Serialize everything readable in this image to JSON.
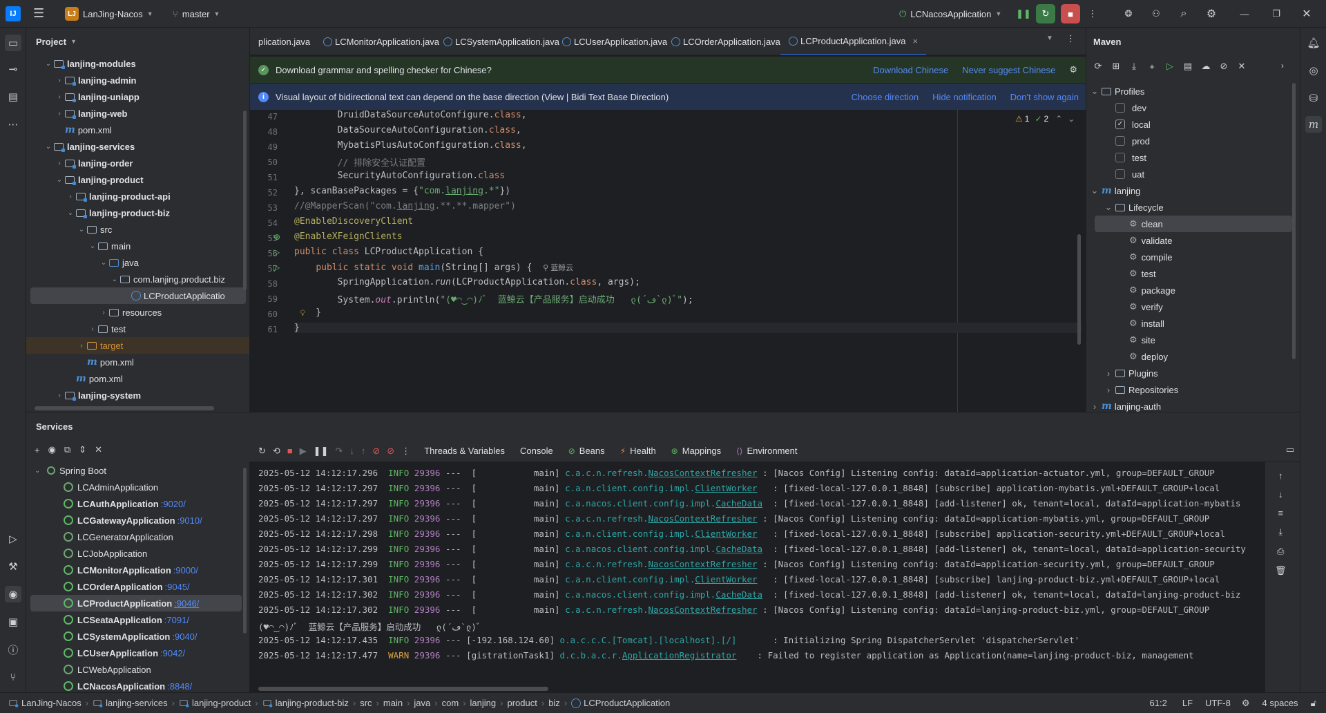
{
  "titlebar": {
    "project_badge": "LJ",
    "project_name": "LanJing-Nacos",
    "branch": "master",
    "run_config": "LCNacosApplication"
  },
  "project_panel": {
    "title": "Project",
    "tree": [
      {
        "label": "lanjing-modules",
        "depth": 1,
        "kind": "module",
        "expanded": true,
        "bold": true
      },
      {
        "label": "lanjing-admin",
        "depth": 2,
        "kind": "module",
        "expanded": false,
        "bold": true
      },
      {
        "label": "lanjing-uniapp",
        "depth": 2,
        "kind": "module",
        "expanded": false,
        "bold": true
      },
      {
        "label": "lanjing-web",
        "depth": 2,
        "kind": "module",
        "expanded": false,
        "bold": true
      },
      {
        "label": "pom.xml",
        "depth": 2,
        "kind": "pom"
      },
      {
        "label": "lanjing-services",
        "depth": 1,
        "kind": "module",
        "expanded": true,
        "bold": true
      },
      {
        "label": "lanjing-order",
        "depth": 2,
        "kind": "module",
        "expanded": false,
        "bold": true
      },
      {
        "label": "lanjing-product",
        "depth": 2,
        "kind": "module",
        "expanded": true,
        "bold": true
      },
      {
        "label": "lanjing-product-api",
        "depth": 3,
        "kind": "module",
        "expanded": false,
        "bold": true
      },
      {
        "label": "lanjing-product-biz",
        "depth": 3,
        "kind": "module",
        "expanded": true,
        "bold": true
      },
      {
        "label": "src",
        "depth": 4,
        "kind": "folder",
        "expanded": true
      },
      {
        "label": "main",
        "depth": 5,
        "kind": "folder",
        "expanded": true
      },
      {
        "label": "java",
        "depth": 6,
        "kind": "src",
        "expanded": true
      },
      {
        "label": "com.lanjing.product.biz",
        "depth": 7,
        "kind": "package",
        "expanded": true
      },
      {
        "label": "LCProductApplicatio",
        "depth": 8,
        "kind": "class",
        "selected": true
      },
      {
        "label": "resources",
        "depth": 6,
        "kind": "folder",
        "expanded": false
      },
      {
        "label": "test",
        "depth": 5,
        "kind": "folder",
        "expanded": false
      },
      {
        "label": "target",
        "depth": 4,
        "kind": "target",
        "expanded": false
      },
      {
        "label": "pom.xml",
        "depth": 4,
        "kind": "pom"
      },
      {
        "label": "pom.xml",
        "depth": 3,
        "kind": "pom"
      },
      {
        "label": "lanjing-system",
        "depth": 2,
        "kind": "module",
        "expanded": false,
        "bold": true
      }
    ]
  },
  "tabs": [
    {
      "label": "plication.java",
      "icon": false
    },
    {
      "label": "LCMonitorApplication.java",
      "icon": true
    },
    {
      "label": "LCSystemApplication.java",
      "icon": true
    },
    {
      "label": "LCUserApplication.java",
      "icon": true
    },
    {
      "label": "LCOrderApplication.java",
      "icon": true
    },
    {
      "label": "LCProductApplication.java",
      "icon": true,
      "active": true
    }
  ],
  "notifications": {
    "grammar": {
      "text": "Download grammar and spelling checker for Chinese?",
      "action1": "Download Chinese",
      "action2": "Never suggest Chinese"
    },
    "bidi": {
      "text": "Visual layout of bidirectional text can depend on the base direction (View | Bidi Text Base Direction)",
      "action1": "Choose direction",
      "action2": "Hide notification",
      "action3": "Don't show again"
    }
  },
  "editor": {
    "inspections": {
      "warnings": "1",
      "ok": "2"
    },
    "author_hint": "蓝鲸云",
    "line_numbers": [
      "47",
      "48",
      "49",
      "50",
      "51",
      "52",
      "53",
      "54",
      "55",
      "56",
      "57",
      "58",
      "59",
      "60",
      "61"
    ]
  },
  "maven": {
    "title": "Maven",
    "tree": [
      {
        "label": "Profiles",
        "depth": 1,
        "kind": "folder",
        "expanded": true
      },
      {
        "label": "dev",
        "depth": 2,
        "kind": "check",
        "checked": false
      },
      {
        "label": "local",
        "depth": 2,
        "kind": "check",
        "checked": true
      },
      {
        "label": "prod",
        "depth": 2,
        "kind": "check",
        "checked": false
      },
      {
        "label": "test",
        "depth": 2,
        "kind": "check",
        "checked": false
      },
      {
        "label": "uat",
        "depth": 2,
        "kind": "check",
        "checked": false
      },
      {
        "label": "lanjing",
        "depth": 1,
        "kind": "mvn",
        "expanded": true
      },
      {
        "label": "Lifecycle",
        "depth": 2,
        "kind": "folder",
        "expanded": true
      },
      {
        "label": "clean",
        "depth": 3,
        "kind": "goal",
        "selected": true
      },
      {
        "label": "validate",
        "depth": 3,
        "kind": "goal"
      },
      {
        "label": "compile",
        "depth": 3,
        "kind": "goal"
      },
      {
        "label": "test",
        "depth": 3,
        "kind": "goal"
      },
      {
        "label": "package",
        "depth": 3,
        "kind": "goal"
      },
      {
        "label": "verify",
        "depth": 3,
        "kind": "goal"
      },
      {
        "label": "install",
        "depth": 3,
        "kind": "goal"
      },
      {
        "label": "site",
        "depth": 3,
        "kind": "goal"
      },
      {
        "label": "deploy",
        "depth": 3,
        "kind": "goal"
      },
      {
        "label": "Plugins",
        "depth": 2,
        "kind": "folder",
        "expanded": false
      },
      {
        "label": "Repositories",
        "depth": 2,
        "kind": "folder",
        "expanded": false
      },
      {
        "label": "lanjing-auth",
        "depth": 1,
        "kind": "mvn",
        "expanded": false
      }
    ]
  },
  "services": {
    "title": "Services",
    "group": "Spring Boot",
    "apps": [
      {
        "name": "LCAdminApplication",
        "port": "",
        "running": false
      },
      {
        "name": "LCAuthApplication",
        "port": ":9020/",
        "running": true
      },
      {
        "name": "LCGatewayApplication",
        "port": ":9010/",
        "running": true
      },
      {
        "name": "LCGeneratorApplication",
        "port": "",
        "running": false
      },
      {
        "name": "LCJobApplication",
        "port": "",
        "running": false
      },
      {
        "name": "LCMonitorApplication",
        "port": ":9000/",
        "running": true
      },
      {
        "name": "LCOrderApplication",
        "port": ":9045/",
        "running": true
      },
      {
        "name": "LCProductApplication",
        "port": ":9046/",
        "running": true,
        "selected": true
      },
      {
        "name": "LCSeataApplication",
        "port": ":7091/",
        "running": true
      },
      {
        "name": "LCSystemApplication",
        "port": ":9040/",
        "running": true
      },
      {
        "name": "LCUserApplication",
        "port": ":9042/",
        "running": true
      },
      {
        "name": "LCWebApplication",
        "port": "",
        "running": false
      },
      {
        "name": "LCNacosApplication",
        "port": ":8848/",
        "running": true
      }
    ],
    "console_tabs": [
      "Threads & Variables",
      "Console",
      "Beans",
      "Health",
      "Mappings",
      "Environment"
    ]
  },
  "console_log": [
    {
      "ts": "2025-05-12 14:12:17.296",
      "level": "INFO",
      "pid": "29396",
      "thread": "---  [           main]",
      "logger_pre": "c.a.c.n.refresh.",
      "logger_link": "NacosContextRefresher",
      "msg": " : [Nacos Config] Listening config: dataId=application-actuator.yml, group=DEFAULT_GROUP"
    },
    {
      "ts": "2025-05-12 14:12:17.297",
      "level": "INFO",
      "pid": "29396",
      "thread": "---  [           main]",
      "logger_pre": "c.a.n.client.config.impl.",
      "logger_link": "ClientWorker",
      "msg": "   : [fixed-local-127.0.0.1_8848] [subscribe] application-mybatis.yml+DEFAULT_GROUP+local"
    },
    {
      "ts": "2025-05-12 14:12:17.297",
      "level": "INFO",
      "pid": "29396",
      "thread": "---  [           main]",
      "logger_pre": "c.a.nacos.client.config.impl.",
      "logger_link": "CacheData",
      "msg": "  : [fixed-local-127.0.0.1_8848] [add-listener] ok, tenant=local, dataId=application-mybatis"
    },
    {
      "ts": "2025-05-12 14:12:17.297",
      "level": "INFO",
      "pid": "29396",
      "thread": "---  [           main]",
      "logger_pre": "c.a.c.n.refresh.",
      "logger_link": "NacosContextRefresher",
      "msg": " : [Nacos Config] Listening config: dataId=application-mybatis.yml, group=DEFAULT_GROUP"
    },
    {
      "ts": "2025-05-12 14:12:17.298",
      "level": "INFO",
      "pid": "29396",
      "thread": "---  [           main]",
      "logger_pre": "c.a.n.client.config.impl.",
      "logger_link": "ClientWorker",
      "msg": "   : [fixed-local-127.0.0.1_8848] [subscribe] application-security.yml+DEFAULT_GROUP+local"
    },
    {
      "ts": "2025-05-12 14:12:17.299",
      "level": "INFO",
      "pid": "29396",
      "thread": "---  [           main]",
      "logger_pre": "c.a.nacos.client.config.impl.",
      "logger_link": "CacheData",
      "msg": "  : [fixed-local-127.0.0.1_8848] [add-listener] ok, tenant=local, dataId=application-security"
    },
    {
      "ts": "2025-05-12 14:12:17.299",
      "level": "INFO",
      "pid": "29396",
      "thread": "---  [           main]",
      "logger_pre": "c.a.c.n.refresh.",
      "logger_link": "NacosContextRefresher",
      "msg": " : [Nacos Config] Listening config: dataId=application-security.yml, group=DEFAULT_GROUP"
    },
    {
      "ts": "2025-05-12 14:12:17.301",
      "level": "INFO",
      "pid": "29396",
      "thread": "---  [           main]",
      "logger_pre": "c.a.n.client.config.impl.",
      "logger_link": "ClientWorker",
      "msg": "   : [fixed-local-127.0.0.1_8848] [subscribe] lanjing-product-biz.yml+DEFAULT_GROUP+local"
    },
    {
      "ts": "2025-05-12 14:12:17.302",
      "level": "INFO",
      "pid": "29396",
      "thread": "---  [           main]",
      "logger_pre": "c.a.nacos.client.config.impl.",
      "logger_link": "CacheData",
      "msg": "  : [fixed-local-127.0.0.1_8848] [add-listener] ok, tenant=local, dataId=lanjing-product-biz"
    },
    {
      "ts": "2025-05-12 14:12:17.302",
      "level": "INFO",
      "pid": "29396",
      "thread": "---  [           main]",
      "logger_pre": "c.a.c.n.refresh.",
      "logger_link": "NacosContextRefresher",
      "msg": " : [Nacos Config] Listening config: dataId=lanjing-product-biz.yml, group=DEFAULT_GROUP"
    },
    {
      "plain": "(♥◠‿◠)ﾉﾞ  蓝鲸云【产品服务】启动成功   ლ(´ڡ`ლ)ﾞ"
    },
    {
      "ts": "2025-05-12 14:12:17.435",
      "level": "INFO",
      "pid": "29396",
      "thread": "--- [-192.168.124.60]",
      "logger_pre": "o.a.c.c.C.[Tomcat].[localhost].[/]",
      "logger_link": "",
      "msg": "       : Initializing Spring DispatcherServlet 'dispatcherServlet'"
    },
    {
      "ts": "2025-05-12 14:12:17.477",
      "level": "WARN",
      "pid": "29396",
      "thread": "--- [gistrationTask1]",
      "logger_pre": "d.c.b.a.c.r.",
      "logger_link": "ApplicationRegistrator",
      "msg": "    : Failed to register application as Application(name=lanjing-product-biz, management"
    }
  ],
  "statusbar": {
    "crumbs": [
      "LanJing-Nacos",
      "lanjing-services",
      "lanjing-product",
      "lanjing-product-biz",
      "src",
      "main",
      "java",
      "com",
      "lanjing",
      "product",
      "biz",
      "LCProductApplication"
    ],
    "position": "61:2",
    "line_sep": "LF",
    "encoding": "UTF-8",
    "indent": "4 spaces"
  }
}
